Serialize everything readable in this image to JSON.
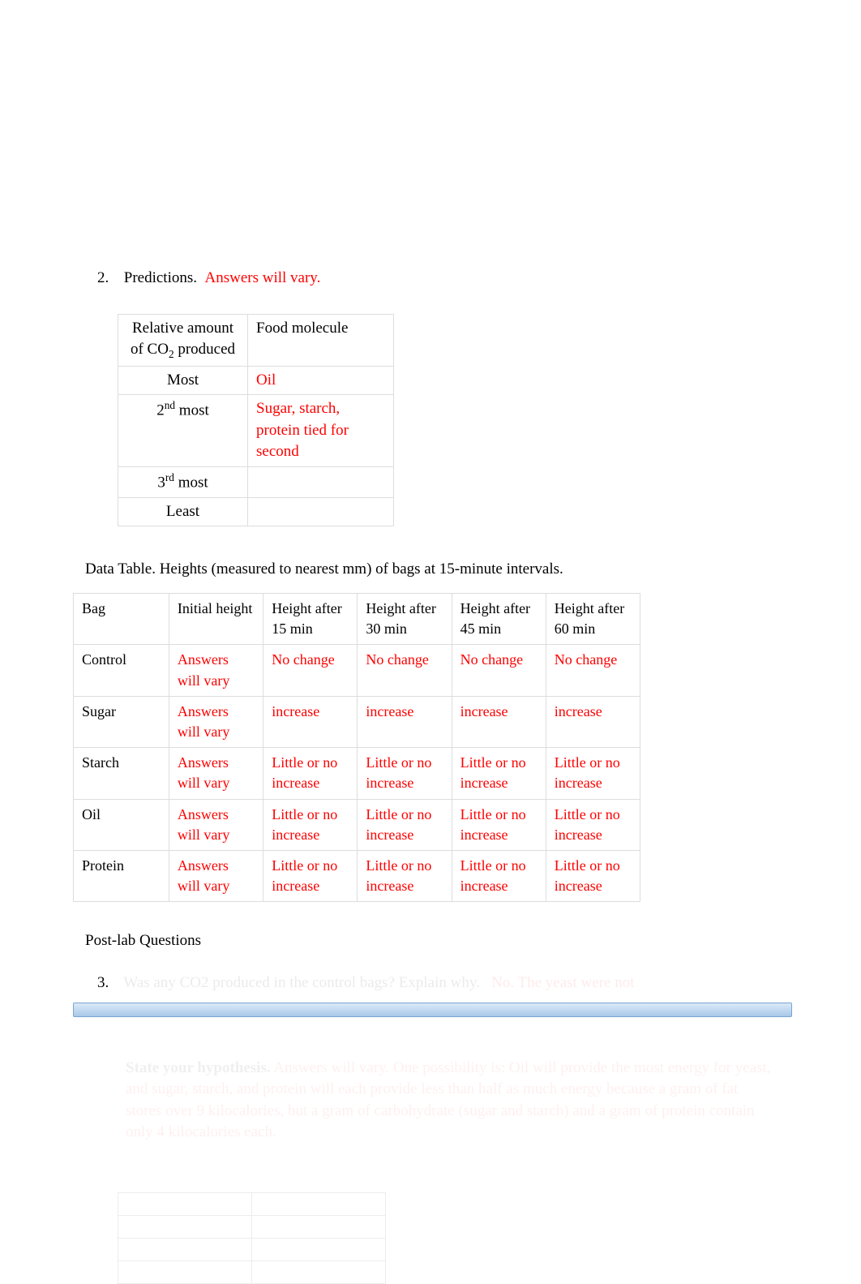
{
  "q2": {
    "number": "2.",
    "label": "Predictions.",
    "answer": "Answers will vary."
  },
  "predTable": {
    "header": {
      "c1": "Relative amount of CO",
      "c1sub": "2",
      "c1cont": " produced",
      "c2": "Food molecule"
    },
    "rows": [
      {
        "rank": "Most",
        "food": "Oil"
      },
      {
        "rankPre": "2",
        "rankSup": "nd",
        "rankPost": " most",
        "food": "Sugar, starch, protein tied for second"
      },
      {
        "rankPre": "3",
        "rankSup": "rd",
        "rankPost": " most",
        "food": ""
      },
      {
        "rank": "Least",
        "food": ""
      }
    ]
  },
  "dataCaption": "Data Table. Heights (measured to nearest mm) of bags at 15-minute intervals.",
  "dataTable": {
    "headers": [
      "Bag",
      "Initial height",
      "Height after 15 min",
      "Height after 30 min",
      "Height after 45 min",
      "Height after 60 min"
    ],
    "rows": [
      {
        "bag": "Control",
        "initial": "Answers will vary",
        "h15": "No change",
        "h30": "No change",
        "h45": "No change",
        "h60": "No change"
      },
      {
        "bag": "Sugar",
        "initial": "Answers will vary",
        "h15": "increase",
        "h30": "increase",
        "h45": "increase",
        "h60": "increase"
      },
      {
        "bag": "Starch",
        "initial": "Answers will vary",
        "h15": "Little or no increase",
        "h30": "Little or no increase",
        "h45": "Little or no increase",
        "h60": "Little or no increase"
      },
      {
        "bag": "Oil",
        "initial": "Answers will vary",
        "h15": "Little or no increase",
        "h30": "Little or no increase",
        "h45": "Little or no increase",
        "h60": "Little or no increase"
      },
      {
        "bag": "Protein",
        "initial": "Answers will vary",
        "h15": "Little or no increase",
        "h30": "Little or no increase",
        "h45": "Little or no increase",
        "h60": "Little or no increase"
      }
    ]
  },
  "postlab": "Post-lab Questions",
  "q3": {
    "number": "3.",
    "textFaint": "Was any CO2 produced in the control bags? Explain why.",
    "answerFaint": "No. The yeast were not"
  },
  "hypothesis": {
    "labelFaint": "State your hypothesis.",
    "answer": "Answers will vary.  One possibility is: Oil will provide the most energy for yeast, and sugar, starch, and protein will each provide less than half as much energy because a gram of fat stores over 9 kilocalories, but a gram of carbohydrate (sugar and starch) and a gram of protein contain only 4 kilocalories each."
  }
}
